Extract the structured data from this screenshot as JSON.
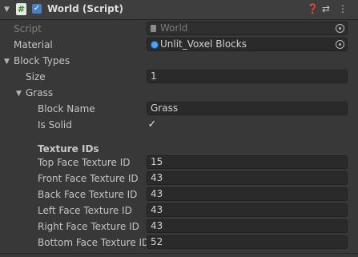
{
  "header": {
    "title": "World (Script)",
    "help_icon": "question-icon",
    "presets_icon": "sliders-icon",
    "menu_icon": "kebab-icon",
    "enabled": true
  },
  "fields": {
    "script_label": "Script",
    "script_value": "World",
    "material_label": "Material",
    "material_value": "Unlit_Voxel Blocks",
    "block_types_label": "Block Types",
    "size_label": "Size",
    "size_value": "1",
    "element_label": "Grass",
    "block_name_label": "Block Name",
    "block_name_value": "Grass",
    "is_solid_label": "Is Solid",
    "is_solid_value": true,
    "texture_ids_header": "Texture IDs",
    "top_label": "Top Face Texture ID",
    "top_value": "15",
    "front_label": "Front Face Texture ID",
    "front_value": "43",
    "back_label": "Back Face Texture ID",
    "back_value": "43",
    "left_label": "Left Face Texture ID",
    "left_value": "43",
    "right_label": "Right Face Texture ID",
    "right_value": "43",
    "bottom_label": "Bottom Face Texture ID",
    "bottom_value": "52"
  },
  "colors": {
    "background": "#383838",
    "field_bg": "#2a2a2a",
    "accent": "#4aa3ff"
  }
}
